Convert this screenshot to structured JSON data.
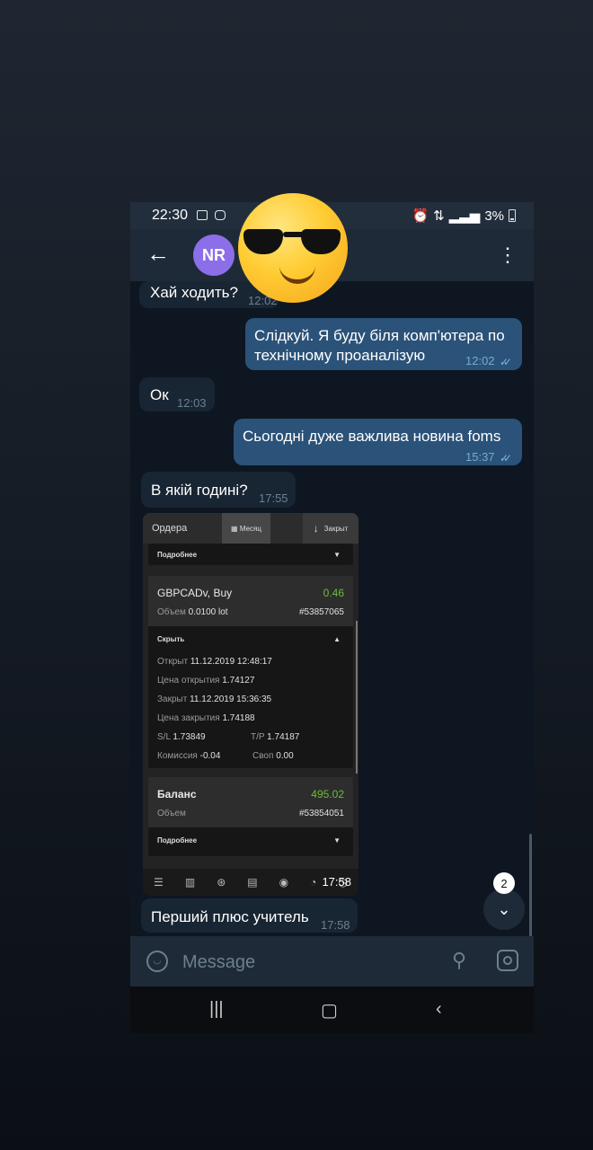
{
  "status": {
    "time": "22:30",
    "battery": "3%"
  },
  "header": {
    "avatar_initials": "NR"
  },
  "messages": [
    {
      "text": "Хай ходить?",
      "time": "12:02"
    },
    {
      "text_line1": "Слідкуй. Я буду біля комп'ютера по",
      "text_line2": "технічному проаналізую",
      "time": "12:02"
    },
    {
      "text": "Ок",
      "time": "12:03"
    },
    {
      "text": "Сьогодні дуже важлива новина foms",
      "time": "15:37"
    },
    {
      "text": "В якій годині?",
      "time": "17:55"
    },
    {
      "text": "Перший плюс учитель",
      "time": "17:58"
    }
  ],
  "screenshot": {
    "title": "Ордера",
    "month": "Месяц",
    "sort": "Закрыт",
    "more": "Подробнее",
    "pair": "GBPCADv, Buy",
    "profit": "0.46",
    "volume_label": "Объем",
    "volume": "0.0100 lot",
    "order_id": "#53857065",
    "hide": "Скрыть",
    "open_label": "Открыт",
    "open": "11.12.2019 12:48:17",
    "open_price_label": "Цена открытия",
    "open_price": "1.74127",
    "close_label": "Закрыт",
    "close": "11.12.2019 15:36:35",
    "close_price_label": "Цена закрытия",
    "close_price": "1.74188",
    "sl_label": "S/L",
    "sl": "1.73849",
    "tp_label": "T/P",
    "tp": "1.74187",
    "commission_label": "Комиссия",
    "commission": "-0.04",
    "swap_label": "Своп",
    "swap": "0.00",
    "balance_label": "Баланс",
    "balance": "495.02",
    "balance_volume_label": "Объем",
    "balance_id": "#53854051",
    "more2": "Подробнее",
    "time": "17:58"
  },
  "unread_count": "2",
  "input": {
    "placeholder": "Message"
  }
}
